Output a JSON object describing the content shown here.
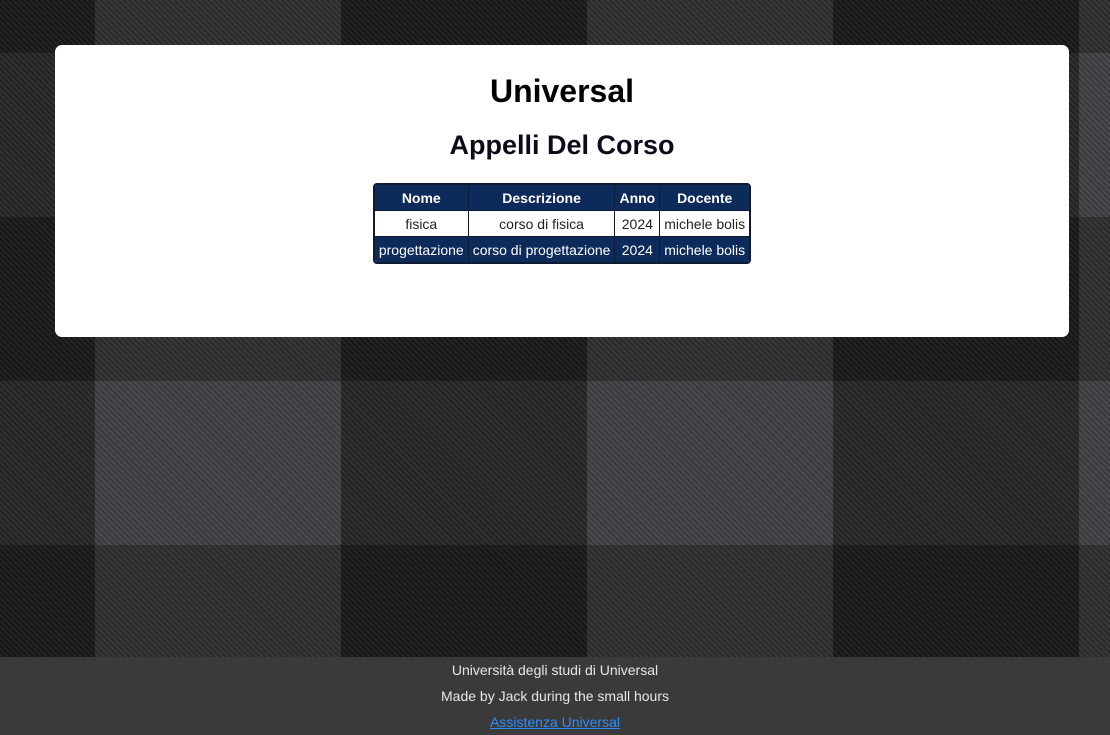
{
  "header": {
    "site_title": "Universal",
    "page_title": "Appelli Del Corso"
  },
  "table": {
    "columns": [
      "Nome",
      "Descrizione",
      "Anno",
      "Docente"
    ],
    "rows": [
      {
        "nome": "fisica",
        "descrizione": "corso di fisica",
        "anno": "2024",
        "docente": "michele bolis"
      },
      {
        "nome": "progettazione",
        "descrizione": "corso di progettazione",
        "anno": "2024",
        "docente": "michele bolis"
      }
    ]
  },
  "footer": {
    "university": "Università degli studi di Universal",
    "credits": "Made by Jack during the small hours",
    "support_link": "Assistenza Universal"
  },
  "colors": {
    "table_header": "#0c2a5a",
    "link": "#2f8cff",
    "footer_bg": "#3a3a3a"
  }
}
